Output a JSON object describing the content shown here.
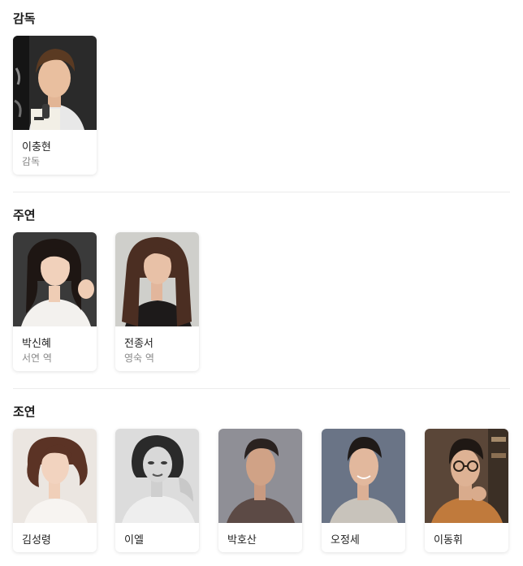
{
  "sections": [
    {
      "title": "감독",
      "people": [
        {
          "name": "이충현",
          "role": "감독",
          "photo": "director-photo"
        }
      ]
    },
    {
      "title": "주연",
      "people": [
        {
          "name": "박신혜",
          "role": "서연 역",
          "photo": "actor-photo"
        },
        {
          "name": "전종서",
          "role": "영숙 역",
          "photo": "actor-photo"
        }
      ]
    },
    {
      "title": "조연",
      "people": [
        {
          "name": "김성령",
          "role": "",
          "photo": "actor-photo"
        },
        {
          "name": "이엘",
          "role": "",
          "photo": "actor-photo"
        },
        {
          "name": "박호산",
          "role": "",
          "photo": "actor-photo"
        },
        {
          "name": "오정세",
          "role": "",
          "photo": "actor-photo"
        },
        {
          "name": "이동휘",
          "role": "",
          "photo": "actor-photo"
        }
      ]
    }
  ],
  "colors": {
    "divider": "#ececec",
    "name": "#222222",
    "role": "#888888"
  }
}
